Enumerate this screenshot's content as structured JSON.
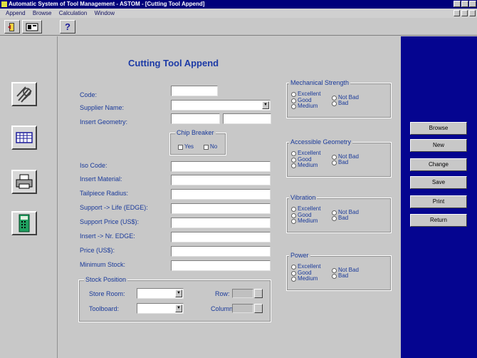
{
  "window": {
    "title": "Automatic System of Tool Management - ASTOM - [Cutting Tool Append]"
  },
  "menu": [
    "Append",
    "Browse",
    "Calculation",
    "Window"
  ],
  "toolbar": {
    "help_label": "?"
  },
  "form": {
    "title": "Cutting Tool Append",
    "labels": {
      "code": "Code:",
      "supplier": "Supplier Name:",
      "insert_geometry": "Insert Geometry:",
      "iso_code": "Iso Code:",
      "insert_material": "Insert Material:",
      "tailpiece": "Tailpiece Radius:",
      "support_life": "Support -> Life (EDGE):",
      "support_price": "Support Price (US$):",
      "insert_edge": "Insert -> Nr. EDGE:",
      "price": "Price (US$):",
      "min_stock": "Minimum Stock:"
    },
    "chip_breaker": {
      "title": "Chip Breaker",
      "yes": "Yes",
      "no": "No"
    },
    "stock": {
      "title": "Stock Position",
      "store_room": "Store Room:",
      "toolboard": "Toolboard:",
      "row": "Row:",
      "column": "Column:"
    }
  },
  "groups": [
    {
      "title": "Mechanical Strength",
      "options": [
        "Excellent",
        "Good",
        "Medium",
        "Not Bad",
        "Bad"
      ]
    },
    {
      "title": "Accessible Geometry",
      "options": [
        "Excellent",
        "Good",
        "Medium",
        "Not Bad",
        "Bad"
      ]
    },
    {
      "title": "Vibration",
      "options": [
        "Excellent",
        "Good",
        "Medium",
        "Not Bad",
        "Bad"
      ]
    },
    {
      "title": "Power",
      "options": [
        "Excellent",
        "Good",
        "Medium",
        "Not Bad",
        "Bad"
      ]
    }
  ],
  "buttons": [
    "Browse",
    "New",
    "Change",
    "Save",
    "Print",
    "Return"
  ],
  "colors": {
    "title_bar": "#00007b",
    "right_panel": "#050590",
    "label": "#1a3a9a",
    "heading": "#1c3aa6"
  }
}
